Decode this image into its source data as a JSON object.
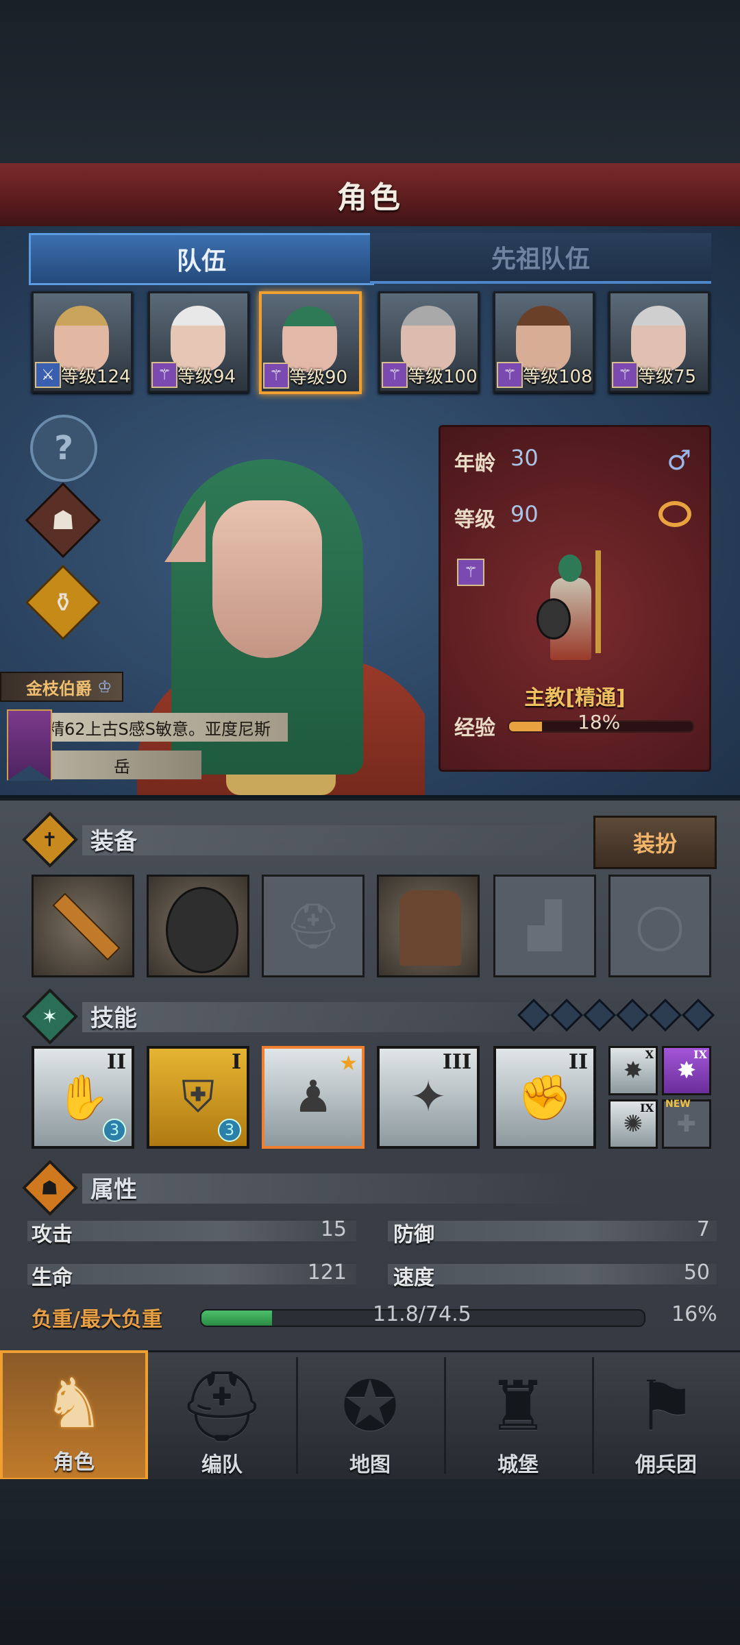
{
  "header": {
    "title": "角色"
  },
  "tabs": [
    {
      "label": "队伍"
    },
    {
      "label": "先祖队伍"
    }
  ],
  "heroes": [
    {
      "level_text": "等级124",
      "class_icon": "sword-icon"
    },
    {
      "level_text": "等级94",
      "class_icon": "staff-icon"
    },
    {
      "level_text": "等级90",
      "class_icon": "staff-icon"
    },
    {
      "level_text": "等级100",
      "class_icon": "staff-icon"
    },
    {
      "level_text": "等级108",
      "class_icon": "staff-icon"
    },
    {
      "level_text": "等级75",
      "class_icon": "staff-icon"
    }
  ],
  "side_icons": {
    "help": "?",
    "profile": "profile-icon",
    "potion": "potion-icon"
  },
  "nameplate": {
    "title": "金枝伯爵",
    "description": "精62上古S感S敏意。亚度尼斯",
    "name": "岳"
  },
  "info_card": {
    "age_label": "年龄",
    "age_value": "30",
    "level_label": "等级",
    "level_value": "90",
    "gender_symbol": "♂",
    "class_name": "主教[精通]",
    "exp_label": "经验",
    "exp_percent_text": "18%",
    "exp_fraction": 0.18
  },
  "equipment": {
    "title": "装备",
    "dress_button": "装扮",
    "slots": [
      {
        "item": "mace",
        "filled": true
      },
      {
        "item": "shield",
        "filled": true
      },
      {
        "item": "helmet",
        "filled": false
      },
      {
        "item": "robe",
        "filled": true
      },
      {
        "item": "boots",
        "filled": false
      },
      {
        "item": "ring",
        "filled": false
      }
    ]
  },
  "skills": {
    "title": "技能",
    "main": [
      {
        "rank": "II",
        "level": "3"
      },
      {
        "rank": "I",
        "level": "3"
      },
      {
        "rank": "",
        "level": ""
      },
      {
        "rank": "III",
        "level": ""
      },
      {
        "rank": "II",
        "level": ""
      }
    ],
    "extra": [
      {
        "rank": "X"
      },
      {
        "rank": "IX"
      },
      {
        "rank": "IX"
      },
      {
        "badge": "NEW"
      }
    ]
  },
  "attributes": {
    "title": "属性",
    "attack_label": "攻击",
    "attack_value": "15",
    "defense_label": "防御",
    "defense_value": "7",
    "hp_label": "生命",
    "hp_value": "121",
    "speed_label": "速度",
    "speed_value": "50",
    "weight_label": "负重/最大负重",
    "weight_text": "11.8/74.5",
    "weight_percent_text": "16%",
    "weight_fraction": 0.16
  },
  "nav": [
    {
      "label": "角色"
    },
    {
      "label": "编队"
    },
    {
      "label": "地图"
    },
    {
      "label": "城堡"
    },
    {
      "label": "佣兵团"
    }
  ]
}
